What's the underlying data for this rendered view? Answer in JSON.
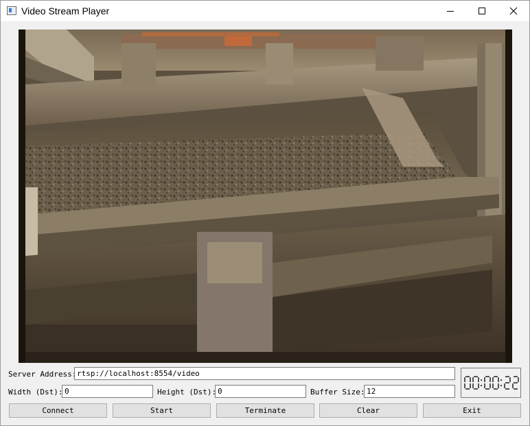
{
  "window": {
    "title": "Video Stream Player"
  },
  "video": {
    "description_icon": "video-frame"
  },
  "form": {
    "server_label": "Server Address:",
    "server_value": "rtsp://localhost:8554/video",
    "width_label": "Width (Dst):",
    "width_value": "0",
    "height_label": "Height (Dst):",
    "height_value": "0",
    "buffer_label": "Buffer Size:",
    "buffer_value": "12"
  },
  "clock": {
    "hours": "00",
    "minutes": "00",
    "seconds": "22",
    "color": "#000000"
  },
  "buttons": {
    "connect": "Connect",
    "start": "Start",
    "terminate": "Terminate",
    "clear": "Clear",
    "exit": "Exit"
  }
}
